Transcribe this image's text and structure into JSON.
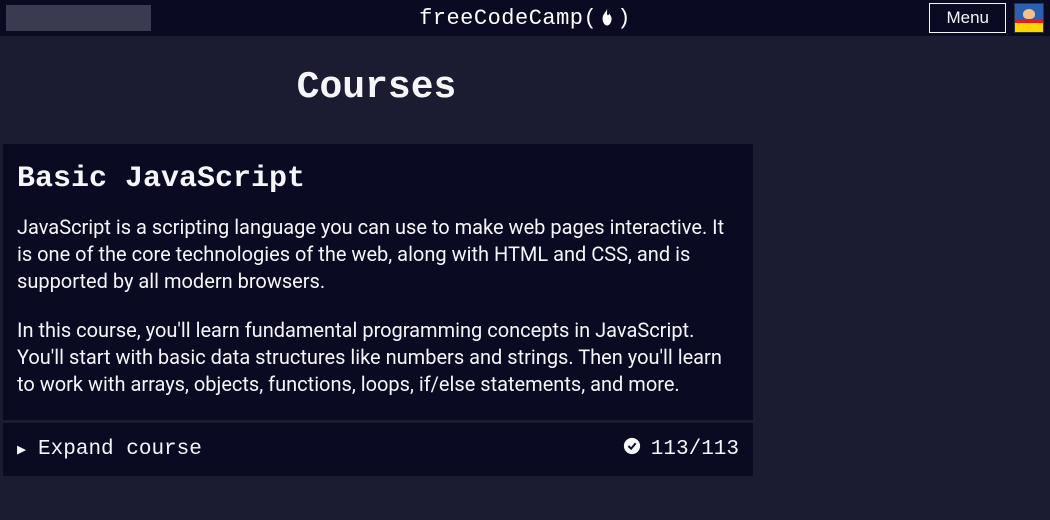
{
  "header": {
    "logo_text_left": "freeCodeCamp(",
    "logo_text_right": ")",
    "menu_label": "Menu"
  },
  "page": {
    "title": "Courses"
  },
  "course": {
    "title": "Basic JavaScript",
    "desc1": "JavaScript is a scripting language you can use to make web pages interactive. It is one of the core technologies of the web, along with HTML and CSS, and is supported by all modern browsers.",
    "desc2": "In this course, you'll learn fundamental programming concepts in JavaScript. You'll start with basic data structures like numbers and strings. Then you'll learn to work with arrays, objects, functions, loops, if/else statements, and more."
  },
  "expand": {
    "label": "Expand course",
    "progress": "113/113"
  }
}
